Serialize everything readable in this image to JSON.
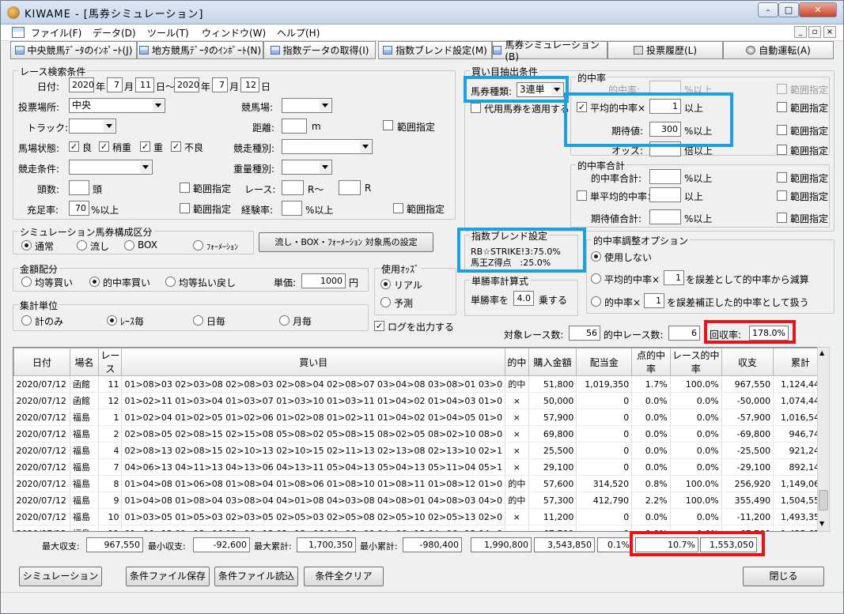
{
  "window": {
    "title": "KIWAME - [馬券シミュレーション]"
  },
  "menu": [
    "ファイル(F)",
    "データ(D)",
    "ツール(T)",
    "ウィンドウ(W)",
    "ヘルプ(H)"
  ],
  "toolbar": [
    "中央競馬ﾃﾞｰﾀのｲﾝﾎﾟｰﾄ(J)",
    "地方競馬ﾃﾞｰﾀのｲﾝﾎﾟｰﾄ(N)",
    "指数データの取得(I)",
    "指数ブレンド設定(M)",
    "馬券シミュレーション(B)",
    "投票履歴(L)",
    "自動運転(A)"
  ],
  "search": {
    "title": "レース検索条件",
    "date_label": "日付:",
    "from_year": "2020",
    "from_month": "7",
    "from_day": "11",
    "to_year": "2020",
    "to_month": "7",
    "to_day": "12",
    "year_unit": "年",
    "month_unit": "月",
    "day_unit": "日",
    "day_range": "日～",
    "venue_label": "投票場所:",
    "venue_value": "中央",
    "course_label": "競馬場:",
    "track_label": "トラック:",
    "distance_label": "距離:",
    "distance_unit": "m",
    "range_label": "範囲指定",
    "condition_label": "馬場状態:",
    "conditions": [
      "良",
      "稍重",
      "重",
      "不良"
    ],
    "race_type_label": "競走種別:",
    "race_cond_label": "競走条件:",
    "weight_label": "重量種別:",
    "heads_label": "頭数:",
    "heads_unit": "頭",
    "race_label": "レース:",
    "race_from_unit": "R～",
    "race_to_unit": "R",
    "fill_label": "充足率:",
    "fill_value": "70",
    "fill_unit": "%以上",
    "exp_label": "経験率:",
    "exp_unit": "%以上"
  },
  "buy": {
    "title": "買い目抽出条件",
    "ticket_label": "馬券種類:",
    "ticket_value": "3連単",
    "proxy_label": "代用馬券を適用する",
    "hit_title": "的中率",
    "hit_rate_label": "的中率:",
    "pct_over": "%以上",
    "range_label": "範囲指定",
    "avg_hit_label": "平均的中率×",
    "avg_hit_value": "1",
    "over": "以上",
    "expect_label": "期待値:",
    "expect_value": "300",
    "odds_label": "オッズ:",
    "odds_unit": "倍以上",
    "total_title": "的中率合計",
    "total_label": "的中率合計:",
    "single_avg_label": "単平均的中率×",
    "expect_total_label": "期待値合計:"
  },
  "blend": {
    "title": "指数ブレンド設定",
    "line1": "RB☆STRIKE!3:75.0%",
    "line2": "馬王Z得点　:25.0%"
  },
  "single": {
    "title": "単勝率計算式",
    "prefix": "単勝率を",
    "value": "4.0",
    "suffix": "乗する"
  },
  "hit_adjust": {
    "title": "的中率調整オプション",
    "opt1": "使用しない",
    "opt2_prefix": "平均的中率×",
    "opt2_value": "1",
    "opt2_suffix": "を誤差として的中率から減算",
    "opt3_prefix": "的中率×",
    "opt3_value": "1",
    "opt3_suffix": "を誤差補正した的中率として扱う"
  },
  "sim": {
    "title": "シミュレーション馬券構成区分",
    "options": [
      "通常",
      "流し",
      "BOX",
      "ﾌｫｰﾒｰｼｮﾝ"
    ],
    "set_button": "流し・BOX・ﾌｫｰﾒｰｼｮﾝ 対象馬の設定"
  },
  "money": {
    "title": "金額配分",
    "options": [
      "均等買い",
      "的中率買い",
      "均等払い戻し"
    ],
    "unit_label": "単価:",
    "unit_value": "1000",
    "unit_suffix": "円"
  },
  "odds": {
    "title": "使用ｵｯｽﾞ",
    "options": [
      "リアル",
      "予測"
    ]
  },
  "agg": {
    "title": "集計単位",
    "options": [
      "計のみ",
      "ﾚｰｽ毎",
      "日毎",
      "月毎"
    ]
  },
  "log": "ログを出力する",
  "summary": {
    "target_label": "対象レース数:",
    "target_value": "56",
    "hit_label": "的中レース数:",
    "hit_value": "6",
    "return_label": "回収率:",
    "return_value": "178.0%"
  },
  "table": {
    "headers": [
      "日付",
      "場名",
      "レース",
      "買い目",
      "的中",
      "購入金額",
      "配当金",
      "点的中率",
      "レース的中率",
      "収支",
      "累計"
    ],
    "rows": [
      [
        "2020/07/12",
        "函館",
        "11",
        "01>08>03 02>03>08 02>08>03 02>08>04 02>08>07 03>04>08 03>08>01 03>0",
        "的中",
        "51,800",
        "1,019,350",
        "1.7%",
        "100.0%",
        "967,550",
        "1,124,440"
      ],
      [
        "2020/07/12",
        "函館",
        "12",
        "01>02>11 01>03>04 01>03>07 01>03>10 01>03>11 01>04>02 01>04>03 01>0",
        "×",
        "50,000",
        "0",
        "0.0%",
        "0.0%",
        "-50,000",
        "1,074,440"
      ],
      [
        "2020/07/12",
        "福島",
        "1",
        "01>02>04 01>02>05 01>02>06 01>02>08 01>02>11 01>04>02 01>04>05 01>0",
        "×",
        "57,900",
        "0",
        "0.0%",
        "0.0%",
        "-57,900",
        "1,016,540"
      ],
      [
        "2020/07/12",
        "福島",
        "2",
        "02>08>05 02>08>15 02>15>08 05>08>02 05>08>15 08>02>05 08>02>10 08>0",
        "×",
        "69,800",
        "0",
        "0.0%",
        "0.0%",
        "-69,800",
        "946,740"
      ],
      [
        "2020/07/12",
        "福島",
        "4",
        "02>08>13 02>08>15 02>10>13 02>10>15 02>11>13 02>13>08 02>13>10 02>1",
        "×",
        "25,500",
        "0",
        "0.0%",
        "0.0%",
        "-25,500",
        "921,240"
      ],
      [
        "2020/07/12",
        "福島",
        "7",
        "04>06>13 04>11>13 04>13>06 04>13>11 05>04>13 05>04>13 05>11>04 05>1",
        "×",
        "29,100",
        "0",
        "0.0%",
        "0.0%",
        "-29,100",
        "892,140"
      ],
      [
        "2020/07/12",
        "福島",
        "8",
        "01>04>08 01>06>08 01>08>04 01>08>06 01>08>10 01>08>11 01>08>12 01>0",
        "的中",
        "57,600",
        "314,520",
        "0.8%",
        "100.0%",
        "256,920",
        "1,149,060"
      ],
      [
        "2020/07/12",
        "福島",
        "9",
        "01>04>08 01>08>04 03>08>04 04>01>08 04>03>08 04>08>01 04>08>03 04>0",
        "的中",
        "57,300",
        "412,790",
        "2.2%",
        "100.0%",
        "355,490",
        "1,504,550"
      ],
      [
        "2020/07/12",
        "福島",
        "10",
        "01>03>05 01>05>03 02>03>05 02>05>03 02>05>08 02>05>10 02>05>13 02>0",
        "×",
        "11,200",
        "0",
        "0.0%",
        "0.0%",
        "-11,200",
        "1,493,350"
      ],
      [
        "2020/07/12",
        "福島",
        "11",
        "01>06>13 01>13>06 02>06>13 02>13>06 04>06>09 04>06>13 04>06>13 04>0",
        "×",
        "67,700",
        "0",
        "0.0%",
        "0.0%",
        "-67,700",
        "1,425,650"
      ]
    ]
  },
  "footer": {
    "max_label": "最大収支:",
    "max_value": "967,550",
    "min_label": "最小収支:",
    "min_value": "-92,600",
    "max_cum_label": "最大累計:",
    "max_cum_value": "1,700,350",
    "min_cum_label": "最小累計:",
    "min_cum_value": "-980,400",
    "total_buy": "1,990,800",
    "total_pay": "3,543,850",
    "total_pt": "0.1%",
    "total_race": "10.7%",
    "total_pl": "1,553,050"
  },
  "buttons": {
    "sim": "シミュレーション",
    "save": "条件ファイル保存",
    "load": "条件ファイル読込",
    "clear": "条件全クリア",
    "close": "閉じる"
  },
  "colors": {
    "highlight_blue": "#1ba1e2",
    "highlight_red": "#e8141b"
  }
}
